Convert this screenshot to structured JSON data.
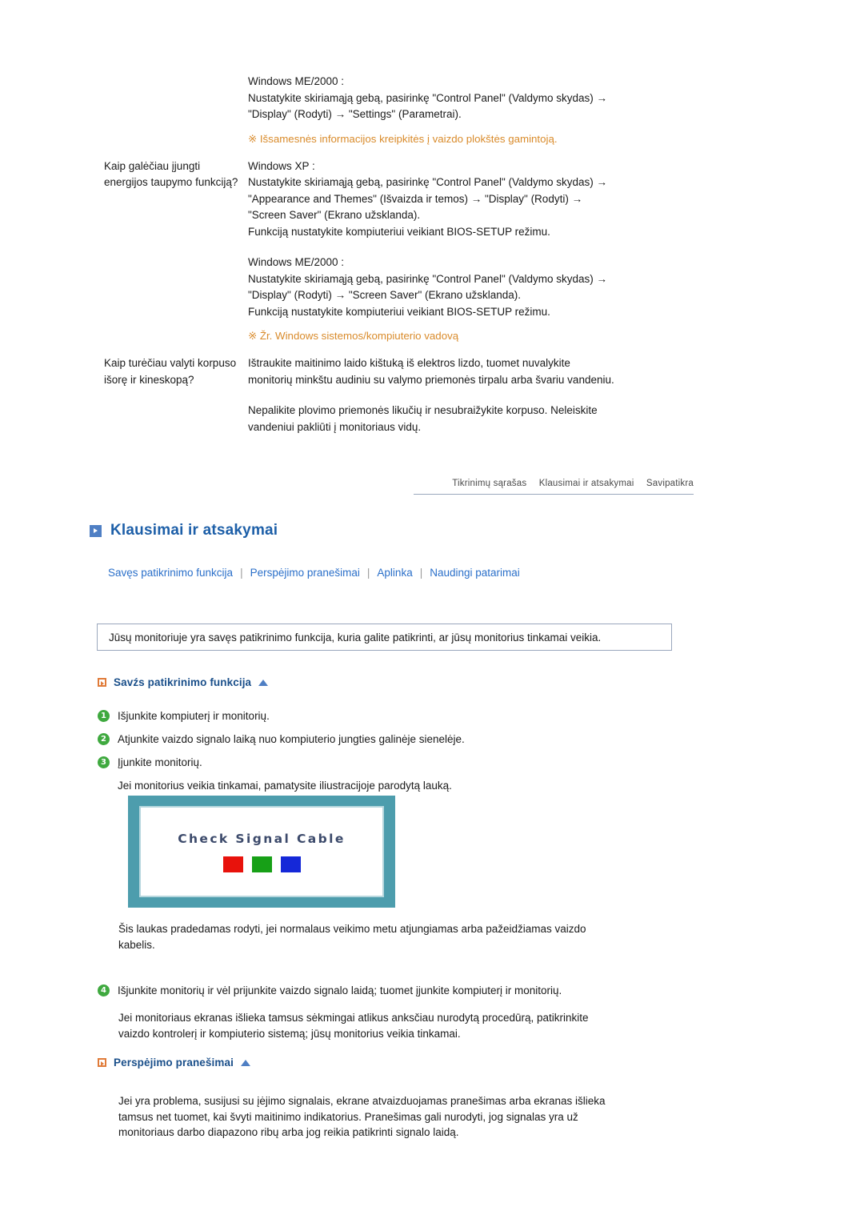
{
  "faq": {
    "rows": [
      {
        "question": "",
        "answer_blocks": [
          {
            "lines": [
              "Windows ME/2000 :",
              "Nustatykite skiriamąją gebą, pasirinkę \"Control Panel\" (Valdymo skydas) →",
              "\"Display\" (Rodyti) → \"Settings\" (Parametrai)."
            ]
          }
        ],
        "note": "※ Išsamesnės informacijos kreipkitės į vaizdo plokštės gamintoją."
      },
      {
        "question": "Kaip galėčiau įjungti energijos taupymo funkciją?",
        "answer_blocks": [
          {
            "lines": [
              "Windows XP :",
              "Nustatykite skiriamąją gebą, pasirinkę \"Control Panel\" (Valdymo skydas) →",
              "\"Appearance and Themes\" (Išvaizda ir temos) → \"Display\" (Rodyti) →",
              "\"Screen Saver\" (Ekrano užsklanda).",
              "Funkciją nustatykite kompiuteriui veikiant BIOS-SETUP režimu."
            ]
          },
          {
            "lines": [
              "Windows ME/2000 :",
              "Nustatykite skiriamąją gebą, pasirinkę \"Control Panel\" (Valdymo skydas) →",
              "\"Display\" (Rodyti) → \"Screen Saver\" (Ekrano užsklanda).",
              "Funkciją nustatykite kompiuteriui veikiant BIOS-SETUP režimu."
            ]
          }
        ],
        "note": "※ Žr. Windows sistemos/kompiuterio vadovą"
      },
      {
        "question": "Kaip turėčiau valyti korpuso išorę ir kineskopą?",
        "answer_blocks": [
          {
            "lines": [
              "Ištraukite maitinimo laido kištuką iš elektros lizdo, tuomet nuvalykite",
              "monitorių minkštu audiniu su valymo priemonės tirpalu arba švariu vandeniu."
            ]
          },
          {
            "lines": [
              "Nepalikite plovimo priemonės likučių ir nesubraižykite korpuso. Neleiskite",
              "vandeniui pakliūti į monitoriaus vidų."
            ]
          }
        ],
        "note": ""
      }
    ]
  },
  "breadcrumb": {
    "items": [
      "Tikrinimų sąrašas",
      "Klausimai ir atsakymai",
      "Savipatikra"
    ]
  },
  "heading": {
    "title": "Klausimai ir atsakymai",
    "icon": "blue-square-arrow-icon"
  },
  "links": [
    "Savęs patikrinimo funkcija",
    "Perspėjimo pranešimai",
    "Aplinka",
    "Naudingi patarimai"
  ],
  "link_separator": "|",
  "intro": {
    "text": "Jūsų monitoriuje yra savęs patikrinimo funkcija, kuria galite patikrinti, ar jūsų monitorius tinkamai veikia."
  },
  "section_selftest": {
    "title": "Savźs patikrinimo funkcija",
    "steps": [
      {
        "num": "1",
        "text": "Išjunkite kompiuterį ir monitorių."
      },
      {
        "num": "2",
        "text": "Atjunkite vaizdo signalo laiką nuo kompiuterio jungties galinėje sienelėje."
      },
      {
        "num": "3",
        "text": "Įjunkite monitorių."
      }
    ],
    "after_steps": "Jei monitorius veikia tinkamai, pamatysite iliustracijoje parodytą lauką.",
    "monitor": {
      "message": "Check Signal Cable",
      "swatches": [
        "#e8120c",
        "#17a017",
        "#1528d8"
      ]
    },
    "note_after_monitor": [
      "Šis laukas pradedamas rodyti, jei normalaus veikimo metu atjungiamas arba pažeidžiamas vaizdo",
      "kabelis."
    ],
    "step4": {
      "num": "4",
      "text": "Išjunkite monitorių ir vėl prijunkite vaizdo signalo laidą; tuomet įjunkite kompiuterį ir monitorių."
    },
    "closing": [
      "Jei monitoriaus ekranas išlieka tamsus sėkmingai atlikus anksčiau nurodytą procedūrą, patikrinkite",
      "vaizdo kontrolerį ir kompiuterio sistemą; jūsų monitorius veikia tinkamai."
    ]
  },
  "section_warning": {
    "title": "Perspėjimo pranešimai",
    "body": [
      "Jei yra problema, susijusi su įėjimo signalais, ekrane atvaizduojamas pranešimas arba ekranas išlieka",
      "tamsus net tuomet, kai švyti maitinimo indikatorius. Pranešimas gali nurodyti, jog signalas yra už",
      "monitoriaus darbo diapazono ribų arba jog reikia patikrinti signalo laidą."
    ]
  },
  "colors": {
    "accent_blue": "#1d5fa8",
    "link_blue": "#2a6fc9",
    "note_orange": "#d98b2b",
    "badge_green": "#3fa93f",
    "monitor_teal": "#4d9dad"
  }
}
